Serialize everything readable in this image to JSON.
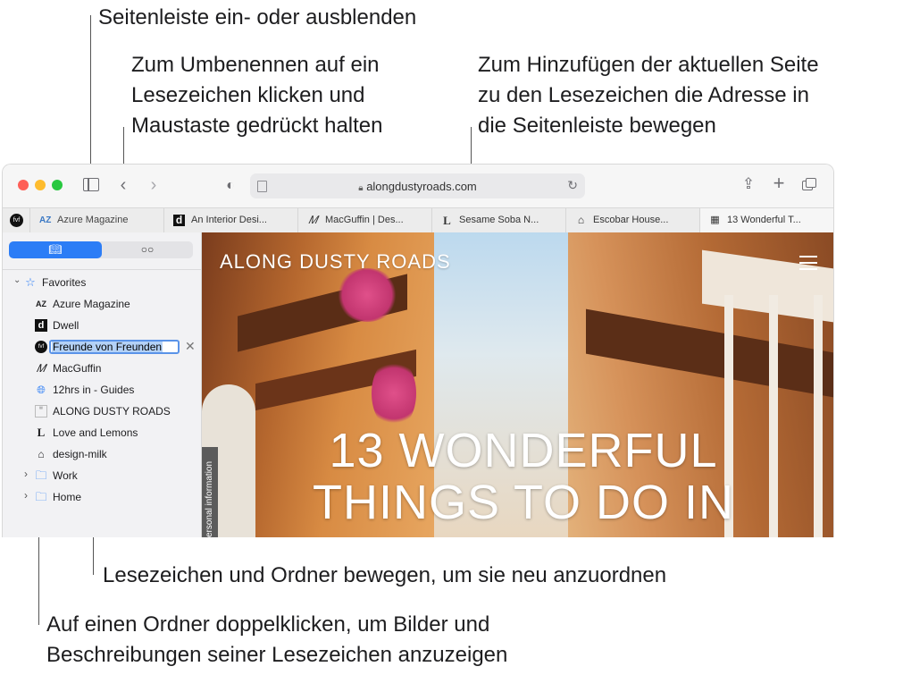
{
  "callouts": {
    "sidebar_toggle": "Seitenleiste ein- oder ausblenden",
    "rename_1": "Zum Umbenennen auf ein",
    "rename_2": "Lesezeichen klicken und",
    "rename_3": "Maustaste gedrückt halten",
    "add_1": "Zum Hinzufügen der aktuellen Seite",
    "add_2": "zu den Lesezeichen die Adresse in",
    "add_3": "die Seitenleiste bewegen",
    "move": "Lesezeichen und Ordner bewegen, um sie neu anzuordnen",
    "folder_1": "Auf einen Ordner doppelklicken, um Bilder und",
    "folder_2": "Beschreibungen seiner Lesezeichen anzuzeigen"
  },
  "toolbar": {
    "url": "alongdustyroads.com"
  },
  "tabs": [
    {
      "icon": "fvf",
      "label": ""
    },
    {
      "icon": "AZ",
      "label": "Azure Magazine"
    },
    {
      "icon": "d",
      "label": "An Interior Desi..."
    },
    {
      "icon": "M",
      "label": "MacGuffin | Des..."
    },
    {
      "icon": "L",
      "label": "Sesame Soba N..."
    },
    {
      "icon": "house",
      "label": "Escobar House..."
    },
    {
      "icon": "grid",
      "label": "13 Wonderful T..."
    }
  ],
  "sidebar": {
    "favorites_label": "Favorites",
    "items": [
      {
        "icon": "AZ",
        "label": "Azure Magazine"
      },
      {
        "icon": "d",
        "label": "Dwell"
      },
      {
        "icon": "fvf",
        "label": "Freunde von Freunden"
      },
      {
        "icon": "M",
        "label": "MacGuffin"
      },
      {
        "icon": "globe",
        "label": "12hrs in - Guides"
      },
      {
        "icon": "adr",
        "label": "ALONG DUSTY ROADS"
      },
      {
        "icon": "L",
        "label": "Love and Lemons"
      },
      {
        "icon": "milk",
        "label": "design-milk"
      }
    ],
    "folders": [
      {
        "label": "Work"
      },
      {
        "label": "Home"
      }
    ]
  },
  "content": {
    "site_title": "ALONG DUSTY ROADS",
    "hero_line1": "13 WONDERFUL",
    "hero_line2": "THINGS TO DO IN",
    "side_tab": "ersonal information"
  },
  "colors": {
    "accent": "#2c7df6",
    "close": "#fe5f57",
    "minimize": "#febc2e",
    "zoom": "#28c840"
  }
}
